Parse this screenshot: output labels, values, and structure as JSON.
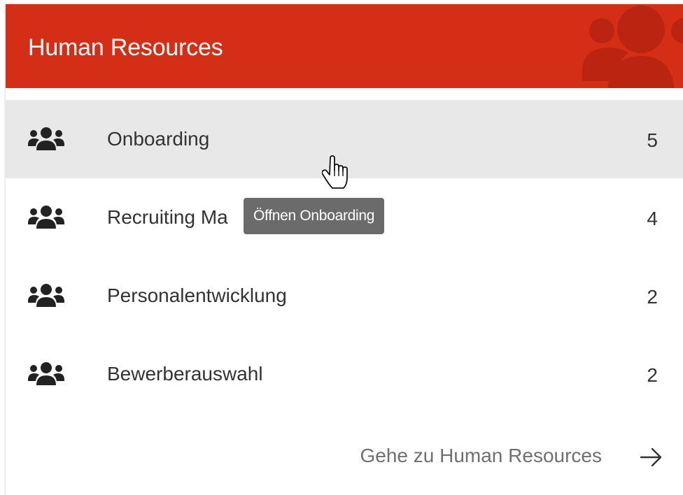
{
  "card": {
    "title": "Human Resources",
    "header_color": "#d42e17",
    "header_icon": "users-icon"
  },
  "items": [
    {
      "icon": "users-icon",
      "label": "Onboarding",
      "count": "5",
      "hovered": true
    },
    {
      "icon": "users-icon",
      "label": "Recruiting Ma",
      "count": "4",
      "hovered": false
    },
    {
      "icon": "users-icon",
      "label": "Personalentwicklung",
      "count": "2",
      "hovered": false
    },
    {
      "icon": "users-icon",
      "label": "Bewerberauswahl",
      "count": "2",
      "hovered": false
    }
  ],
  "footer": {
    "link_label": "Gehe zu Human Resources",
    "arrow_icon": "arrow-right-icon"
  },
  "tooltip": {
    "text": "Öffnen Onboarding"
  },
  "cursor": {
    "icon": "hand-pointer-icon"
  }
}
